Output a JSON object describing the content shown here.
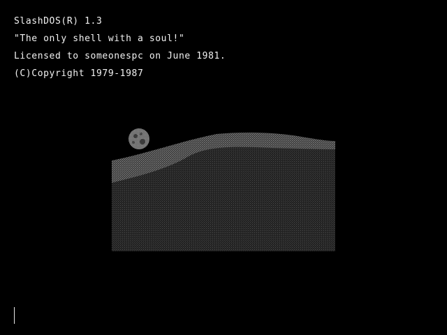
{
  "terminal": {
    "lines": [
      "SlashDOS(R) 1.3",
      "\"The only shell with a soul!\"",
      "Licensed to someonespc on June 1981.",
      "(C)Copyright 1979-1987"
    ]
  },
  "splash": {
    "subject": "moon-over-dunes-illustration"
  },
  "colors": {
    "background": "#000000",
    "text": "#f2f2f2",
    "dune_light": "#5a5a5a",
    "dune_dark": "#2e2e2e"
  },
  "prompt": {
    "cursor": "text-cursor"
  }
}
